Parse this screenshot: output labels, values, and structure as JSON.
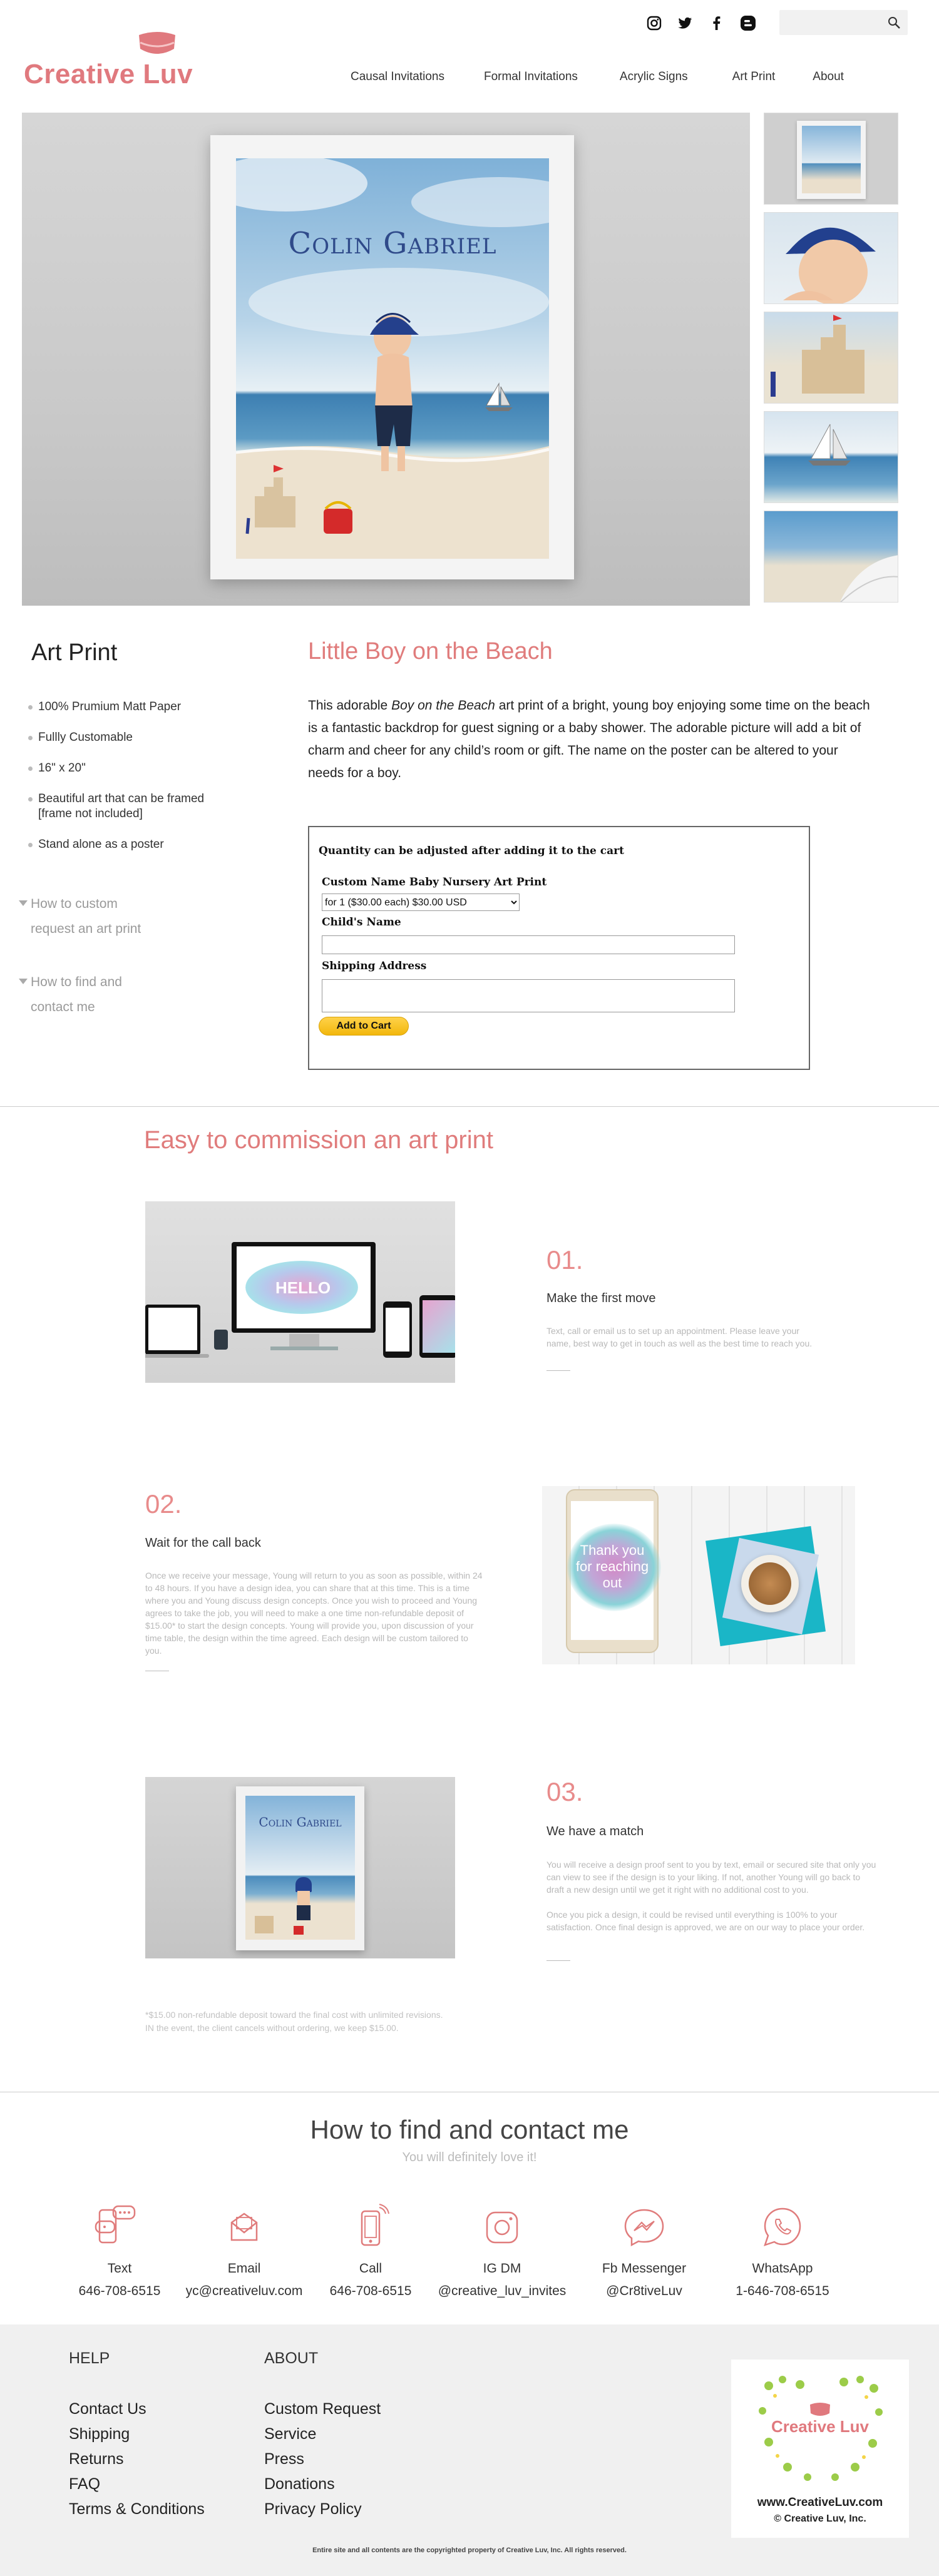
{
  "header": {
    "logo_text": "Creative Luv",
    "social_icons": [
      "instagram-icon",
      "twitter-icon",
      "facebook-icon",
      "blogger-icon"
    ],
    "search_placeholder": "",
    "nav": [
      "Causal Invitations",
      "Formal Invitations",
      "Acrylic Signs",
      "Art Print",
      "About"
    ]
  },
  "gallery": {
    "poster_name": "Colin Gabriel",
    "thumbnails": 5
  },
  "sidebar": {
    "title": "Art Print",
    "features": [
      "100% Prumium Matt Paper",
      "Fullly Customable",
      "16\" x 20\"",
      "Beautiful art that can be framed [frame not included]",
      "Stand alone as a poster"
    ],
    "links": [
      {
        "line1": "How to custom",
        "line2": "request an art print"
      },
      {
        "line1": "How to find and",
        "line2": "contact me"
      }
    ]
  },
  "product": {
    "title": "Little Boy on the Beach",
    "desc_pre": "This adorable ",
    "desc_em": "Boy on the Beach",
    "desc_post": " art print of a bright, young boy enjoying some time on the beach is a fantastic backdrop for guest signing or a baby shower. The adorable picture will add a bit of charm and cheer for any child’s room or gift. The name on the poster can be altered to your needs for a boy.",
    "form": {
      "note": "Quantity can be adjusted after adding it to the cart",
      "item_label": "Custom Name Baby Nursery Art Print",
      "option": "for 1 ($30.00 each) $30.00 USD",
      "child_label": "Child's Name",
      "address_label": "Shipping Address",
      "button": "Add to Cart"
    }
  },
  "process": {
    "title": "Easy to commission an art print",
    "steps": [
      {
        "num": "01.",
        "head": "Make the first move",
        "body": "Text, call or email us to set up an appointment. Please leave your name, best way to get in touch as well as the best time to reach you.",
        "screen_word": "HELLO"
      },
      {
        "num": "02.",
        "head": "Wait for the call back",
        "body": "Once we receive your message, Young will return to you as soon as possible, within 24 to 48 hours. If you have a design idea, you can share that at this time. This is a time where you and Young discuss design concepts. Once you wish to proceed and Young agrees to take the job, you will need to make a one time non-refundable deposit of $15.00* to start the design concepts. Young will provide you, upon discussion of your time table, the design within the time agreed. Each design will be custom tailored to you.",
        "screen_word": "Thank you for reaching out"
      },
      {
        "num": "03.",
        "head": "We have a match",
        "body": "You will receive a design proof sent to you by text, email or secured site that only you can view to see if the design is to your liking. If not, another Young will go back to draft a new design until we get it right with no additional cost to you.",
        "body2": "Once you pick a design, it could be revised until everything is 100% to your satisfaction. Once final design is approved, we are on our way to place your order."
      }
    ],
    "footnote_1": "*$15.00 non-refundable deposit toward the final cost with unlimited revisions.",
    "footnote_2": "IN the event, the client cancels without ordering, we keep $15.00."
  },
  "contact": {
    "title": "How to find and contact me",
    "subtitle": "You will definitely love it!",
    "items": [
      {
        "label": "Text",
        "value": "646-708-6515",
        "icon": "text-message-icon"
      },
      {
        "label": "Email",
        "value": "yc@creativeluv.com",
        "icon": "email-icon"
      },
      {
        "label": "Call",
        "value": "646-708-6515",
        "icon": "phone-icon"
      },
      {
        "label": "IG DM",
        "value": "@creative_luv_invites",
        "icon": "instagram-icon"
      },
      {
        "label": "Fb Messenger",
        "value": "@Cr8tiveLuv",
        "icon": "messenger-icon"
      },
      {
        "label": "WhatsApp",
        "value": "1-646-708-6515",
        "icon": "whatsapp-icon"
      }
    ]
  },
  "footer": {
    "help_title": "HELP",
    "help_links": [
      "Contact Us",
      "Shipping",
      "Returns",
      "FAQ",
      "Terms & Conditions"
    ],
    "about_title": "ABOUT",
    "about_links": [
      "Custom Request",
      "Service",
      "Press",
      "Donations",
      "Privacy Policy"
    ],
    "badge_logo": "Creative Luv",
    "badge_url": "www.CreativeLuv.com",
    "badge_copy": "© Creative Luv, Inc.",
    "copyright": "Entire site and all contents are the copyrighted property of Creative Luv, Inc. All rights reserved."
  },
  "colors": {
    "brand": "#e07c7c",
    "accent_yellow": "#f2b70c"
  }
}
